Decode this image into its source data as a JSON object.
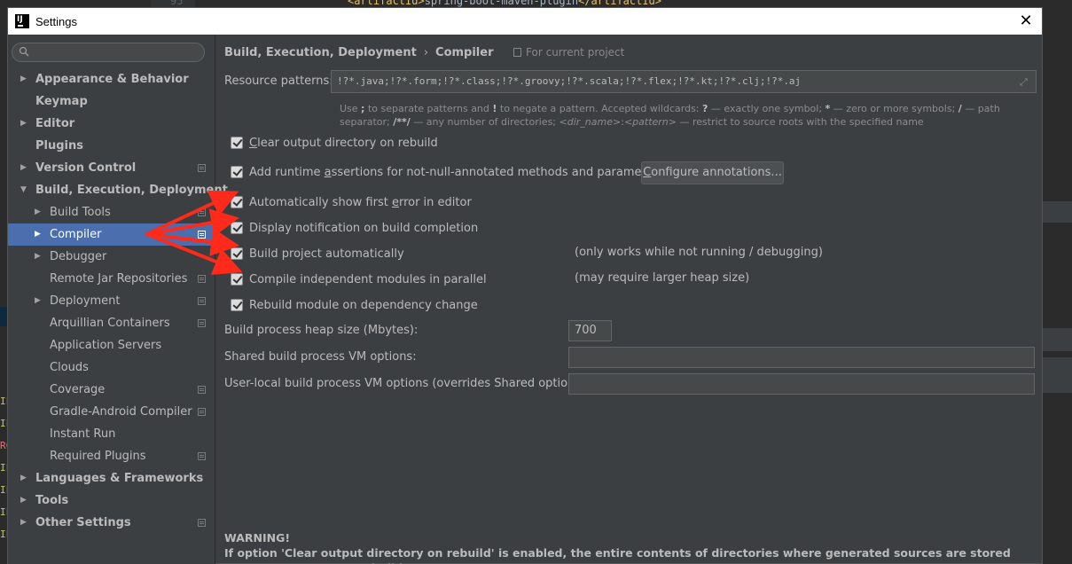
{
  "background": {
    "line_number": "95",
    "code_open_tag": "<artifactId>",
    "code_text": "spring-boot-maven-plugin",
    "code_close_tag": "</artifactId>",
    "left_strip": [
      "IF",
      "IF",
      "RC",
      "IF",
      "IF",
      "IF",
      "IF"
    ]
  },
  "dialog": {
    "title": "Settings"
  },
  "sidebar": {
    "search_placeholder": "",
    "items": [
      {
        "label": "Appearance & Behavior",
        "level": 0,
        "arrow": "right",
        "bold": true
      },
      {
        "label": "Keymap",
        "level": 0,
        "arrow": "",
        "bold": true
      },
      {
        "label": "Editor",
        "level": 0,
        "arrow": "right",
        "bold": true
      },
      {
        "label": "Plugins",
        "level": 0,
        "arrow": "",
        "bold": true
      },
      {
        "label": "Version Control",
        "level": 0,
        "arrow": "right",
        "bold": true,
        "proj": true
      },
      {
        "label": "Build, Execution, Deployment",
        "level": 0,
        "arrow": "down",
        "bold": true
      },
      {
        "label": "Build Tools",
        "level": 1,
        "arrow": "right",
        "proj": true
      },
      {
        "label": "Compiler",
        "level": 1,
        "arrow": "right",
        "proj": true,
        "selected": true
      },
      {
        "label": "Debugger",
        "level": 1,
        "arrow": "right"
      },
      {
        "label": "Remote Jar Repositories",
        "level": 1,
        "arrow": "",
        "proj": true
      },
      {
        "label": "Deployment",
        "level": 1,
        "arrow": "right",
        "proj": true
      },
      {
        "label": "Arquillian Containers",
        "level": 1,
        "arrow": "",
        "proj": true
      },
      {
        "label": "Application Servers",
        "level": 1,
        "arrow": ""
      },
      {
        "label": "Clouds",
        "level": 1,
        "arrow": ""
      },
      {
        "label": "Coverage",
        "level": 1,
        "arrow": "",
        "proj": true
      },
      {
        "label": "Gradle-Android Compiler",
        "level": 1,
        "arrow": "",
        "proj": true
      },
      {
        "label": "Instant Run",
        "level": 1,
        "arrow": ""
      },
      {
        "label": "Required Plugins",
        "level": 1,
        "arrow": "",
        "proj": true
      },
      {
        "label": "Languages & Frameworks",
        "level": 0,
        "arrow": "right",
        "bold": true
      },
      {
        "label": "Tools",
        "level": 0,
        "arrow": "right",
        "bold": true
      },
      {
        "label": "Other Settings",
        "level": 0,
        "arrow": "right",
        "bold": true,
        "proj": true
      }
    ]
  },
  "content": {
    "breadcrumb_parent": "Build, Execution, Deployment",
    "breadcrumb_sep": "›",
    "breadcrumb_current": "Compiler",
    "for_project": "For current project",
    "resource_label": "Resource patterns:",
    "resource_value": "!?*.java;!?*.form;!?*.class;!?*.groovy;!?*.scala;!?*.flex;!?*.kt;!?*.clj;!?*.aj",
    "hint": {
      "p1": "Use ",
      "b1": ";",
      "p2": " to separate patterns and ",
      "b2": "!",
      "p3": " to negate a pattern. Accepted wildcards: ",
      "b3": "?",
      "p4": " — exactly one symbol; ",
      "b4": "*",
      "p5": " — zero or more symbols; ",
      "b5": "/",
      "p6": " — path separator; ",
      "b6": "/**/",
      "p7": " — any number of directories; ",
      "i1": "<dir_name>",
      "p8": ":",
      "i2": "<pattern>",
      "p9": " — restrict to source roots with the specified name"
    },
    "checkboxes": [
      {
        "pre": "",
        "u": "C",
        "post": "lear output directory on rebuild",
        "checked": true
      },
      {
        "pre": "Add runtime ",
        "u": "a",
        "post": "ssertions for not-null-annotated methods and parameters",
        "checked": true
      },
      {
        "pre": "Automatically show first ",
        "u": "e",
        "post": "rror in editor",
        "checked": true
      },
      {
        "pre": "Display notification on build completion",
        "u": "",
        "post": "",
        "checked": true
      },
      {
        "pre": "Build project automatically",
        "u": "",
        "post": "",
        "checked": true
      },
      {
        "pre": "Compile independent modules in parallel",
        "u": "",
        "post": "",
        "checked": false
      },
      {
        "pre": "Rebuild module on dependency change",
        "u": "",
        "post": "",
        "checked": true
      }
    ],
    "configure_pre": "",
    "configure_u": "C",
    "configure_post": "onfigure annotations...",
    "note_build_auto": "(only works while not running / debugging)",
    "note_parallel": "(may require larger heap size)",
    "heap_label": "Build process heap size (Mbytes):",
    "heap_value": "700",
    "shared_vm_label": "Shared build process VM options:",
    "shared_vm_value": "",
    "user_vm_label": "User-local build process VM options (overrides Shared options):",
    "user_vm_value": "",
    "warning_title": "WARNING!",
    "warning_text": "If option 'Clear output directory on rebuild' is enabled, the entire contents of directories where generated sources are stored WILL BE CLEARED on rebuild."
  },
  "colors": {
    "selection": "#4b6eaf",
    "arrow_annotation": "#ff2a1a",
    "panel": "#3c3f41"
  }
}
